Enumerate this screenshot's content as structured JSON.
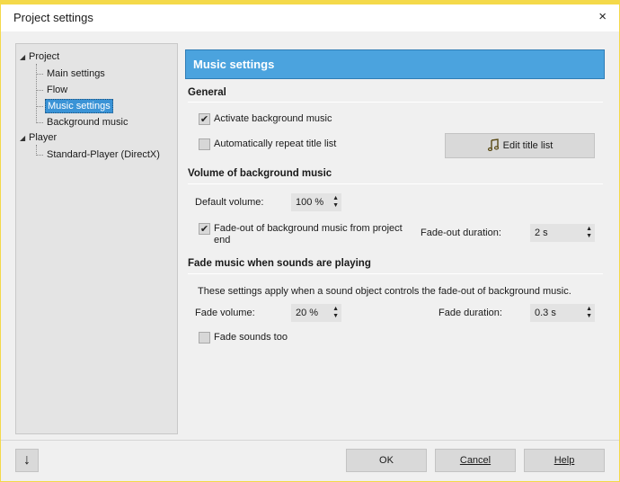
{
  "window": {
    "title": "Project settings",
    "close": "×"
  },
  "tree": {
    "project": "Project",
    "project_items": [
      "Main settings",
      "Flow",
      "Music settings",
      "Background music"
    ],
    "player": "Player",
    "player_items": [
      "Standard-Player (DirectX)"
    ]
  },
  "header": {
    "title": "Music settings"
  },
  "general": {
    "title": "General",
    "activate_bg": "Activate background music",
    "activate_bg_checked": true,
    "auto_repeat": "Automatically repeat title list",
    "auto_repeat_checked": false,
    "edit_title_list": "Edit title list"
  },
  "volume": {
    "title": "Volume of background music",
    "default_volume_label": "Default volume:",
    "default_volume_value": "100 %",
    "fadeout_label": "Fade-out of background music from project end",
    "fadeout_checked": true,
    "fadeout_duration_label": "Fade-out duration:",
    "fadeout_duration_value": "2 s"
  },
  "fade_sounds": {
    "title": "Fade music when sounds are playing",
    "description": "These settings apply when a sound object controls the fade-out of background music.",
    "fade_volume_label": "Fade volume:",
    "fade_volume_value": "20 %",
    "fade_duration_label": "Fade duration:",
    "fade_duration_value": "0.3 s",
    "fade_sounds_too": "Fade sounds too",
    "fade_sounds_too_checked": false
  },
  "footer": {
    "ok": "OK",
    "cancel": "Cancel",
    "help": "Help",
    "down_arrow": "↓"
  },
  "colors": {
    "accent": "#4ba3de",
    "window_border": "#f4d94a",
    "selection": "#3a93d6"
  }
}
